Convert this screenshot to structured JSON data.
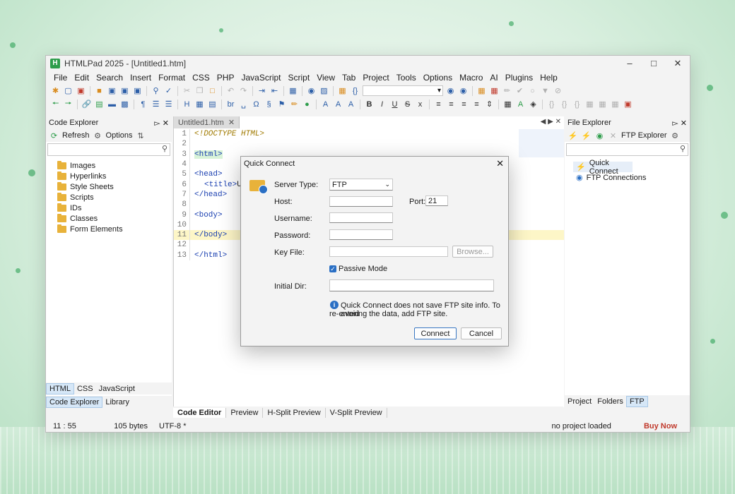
{
  "window": {
    "title": "HTMLPad 2025 - [Untitled1.htm]",
    "logo": "H"
  },
  "menu": [
    "File",
    "Edit",
    "Search",
    "Insert",
    "Format",
    "CSS",
    "PHP",
    "JavaScript",
    "Script",
    "View",
    "Tab",
    "Project",
    "Tools",
    "Options",
    "Macro",
    "AI",
    "Plugins",
    "Help"
  ],
  "left_panel": {
    "title": "Code Explorer",
    "refresh": "Refresh",
    "options": "Options",
    "items": [
      "Images",
      "Hyperlinks",
      "Style Sheets",
      "Scripts",
      "IDs",
      "Classes",
      "Form Elements"
    ],
    "lang_tabs": [
      "HTML",
      "CSS",
      "JavaScript"
    ],
    "bottom_tabs": [
      "Code Explorer",
      "Library"
    ]
  },
  "editor": {
    "tab": "Untitled1.htm",
    "lines": [
      "1",
      "2",
      "3",
      "4",
      "5",
      "6",
      "7",
      "8",
      "9",
      "10",
      "11",
      "12",
      "13"
    ],
    "code": {
      "l1": "<!DOCTYPE HTML>",
      "l3": "<html>",
      "l5": "<head>",
      "l6_tag": "<title>",
      "l6_text": "Unt",
      "l7": "</head>",
      "l9": "<body>",
      "l11": "</body>",
      "l13": "</html>"
    },
    "bottom_tabs": [
      "Code Editor",
      "Preview",
      "H-Split Preview",
      "V-Split Preview"
    ]
  },
  "right_panel": {
    "title": "File Explorer",
    "ftp_explorer": "FTP Explorer",
    "items": [
      "Quick Connect",
      "FTP Connections"
    ],
    "bottom_tabs": [
      "Project",
      "Folders",
      "FTP"
    ]
  },
  "status": {
    "position": "11 : 55",
    "size": "105 bytes",
    "encoding": "UTF-8 *",
    "project": "no project loaded",
    "buy": "Buy Now"
  },
  "dialog": {
    "title": "Quick Connect",
    "server_type_label": "Server Type:",
    "server_type_value": "FTP",
    "host_label": "Host:",
    "host_value": "",
    "port_label": "Port:",
    "port_value": "21",
    "username_label": "Username:",
    "password_label": "Password:",
    "keyfile_label": "Key File:",
    "browse": "Browse...",
    "passive_label": "Passive Mode",
    "passive_checked": true,
    "initial_dir_label": "Initial Dir:",
    "info_line1": "Quick Connect does not save FTP site info. To avoid",
    "info_line2": "re-entering the data, add FTP site.",
    "connect": "Connect",
    "cancel": "Cancel"
  }
}
